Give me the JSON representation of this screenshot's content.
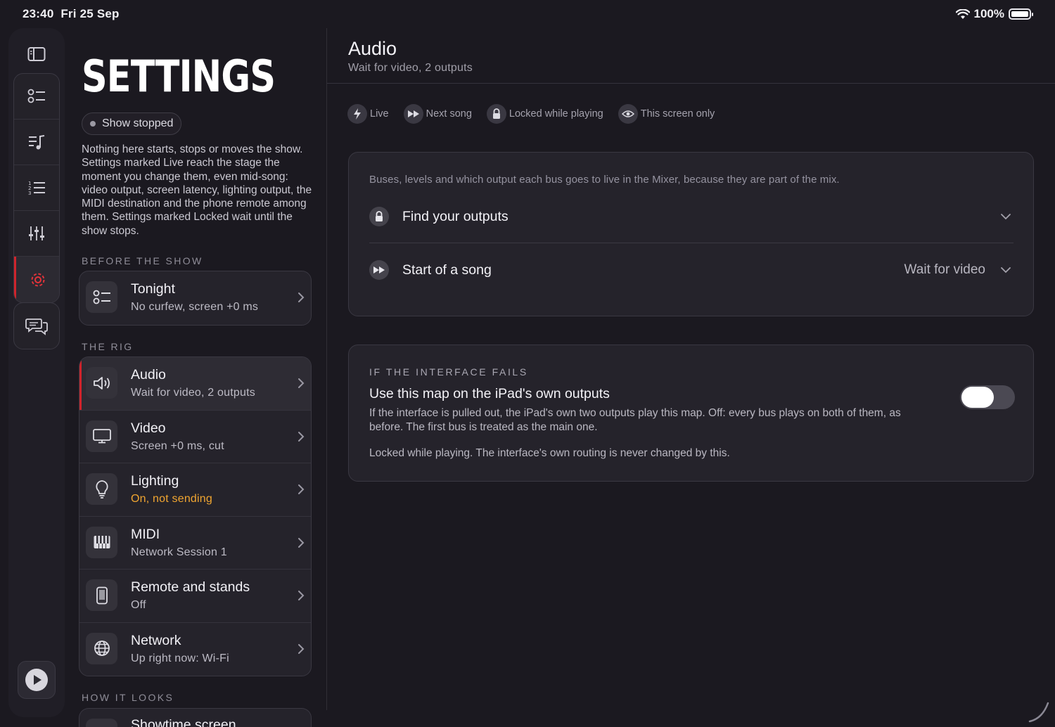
{
  "status": {
    "time": "23:40",
    "date": "Fri 25 Sep",
    "battery": "100%"
  },
  "sidebar": {
    "title": "SETTINGS",
    "show_state": "Show stopped",
    "intro": "Nothing here starts, stops or moves the show. Settings marked Live reach the stage the moment you change them, even mid-song: video output, screen latency, lighting output, the MIDI destination and the phone remote among them. Settings marked Locked wait until the show stops.",
    "sections": [
      {
        "label": "BEFORE THE SHOW",
        "items": [
          {
            "title": "Tonight",
            "sub": "No curfew, screen +0 ms",
            "icon": "checklist-icon"
          }
        ]
      },
      {
        "label": "THE RIG",
        "items": [
          {
            "title": "Audio",
            "sub": "Wait for video, 2 outputs",
            "icon": "speaker-icon"
          },
          {
            "title": "Video",
            "sub": "Screen +0 ms, cut",
            "icon": "monitor-icon"
          },
          {
            "title": "Lighting",
            "sub": "On, not sending",
            "icon": "lightbulb-icon"
          },
          {
            "title": "MIDI",
            "sub": "Network Session 1",
            "icon": "piano-keys-icon"
          },
          {
            "title": "Remote and stands",
            "sub": "Off",
            "icon": "phone-icon"
          },
          {
            "title": "Network",
            "sub": "Up right now: Wi-Fi",
            "icon": "globe-icon"
          }
        ]
      },
      {
        "label": "HOW IT LOOKS",
        "items": [
          {
            "title": "Showtime screen",
            "icon": "screen-icon"
          }
        ]
      }
    ]
  },
  "panel": {
    "title": "Audio",
    "subtitle": "Wait for video, 2 outputs",
    "legend": [
      {
        "label": "Live",
        "icon": "bolt-icon"
      },
      {
        "label": "Next song",
        "icon": "fast-forward-icon"
      },
      {
        "label": "Locked while playing",
        "icon": "lock-icon"
      },
      {
        "label": "This screen only",
        "icon": "eye-icon"
      }
    ],
    "card1": {
      "note": "Buses, levels and which output each bus goes to live in the Mixer, because they are part of the mix.",
      "options": [
        {
          "label": "Find your outputs",
          "value": "",
          "icon": "lock-icon"
        },
        {
          "label": "Start of a song",
          "value": "Wait for video",
          "icon": "fast-forward-icon"
        }
      ]
    },
    "card2": {
      "kicker": "IF THE INTERFACE FAILS",
      "title": "Use this map on the iPad's own outputs",
      "desc": "If the interface is pulled out, the iPad's own two outputs play this map. Off: every bus plays on both of them, as before. The first bus is treated as the main one.",
      "desc2": "Locked while playing. The interface's own routing is never changed by this.",
      "toggle_on": false
    }
  },
  "colors": {
    "accent": "#d0242c",
    "warning": "#f0a531",
    "background": "#1b1920"
  }
}
